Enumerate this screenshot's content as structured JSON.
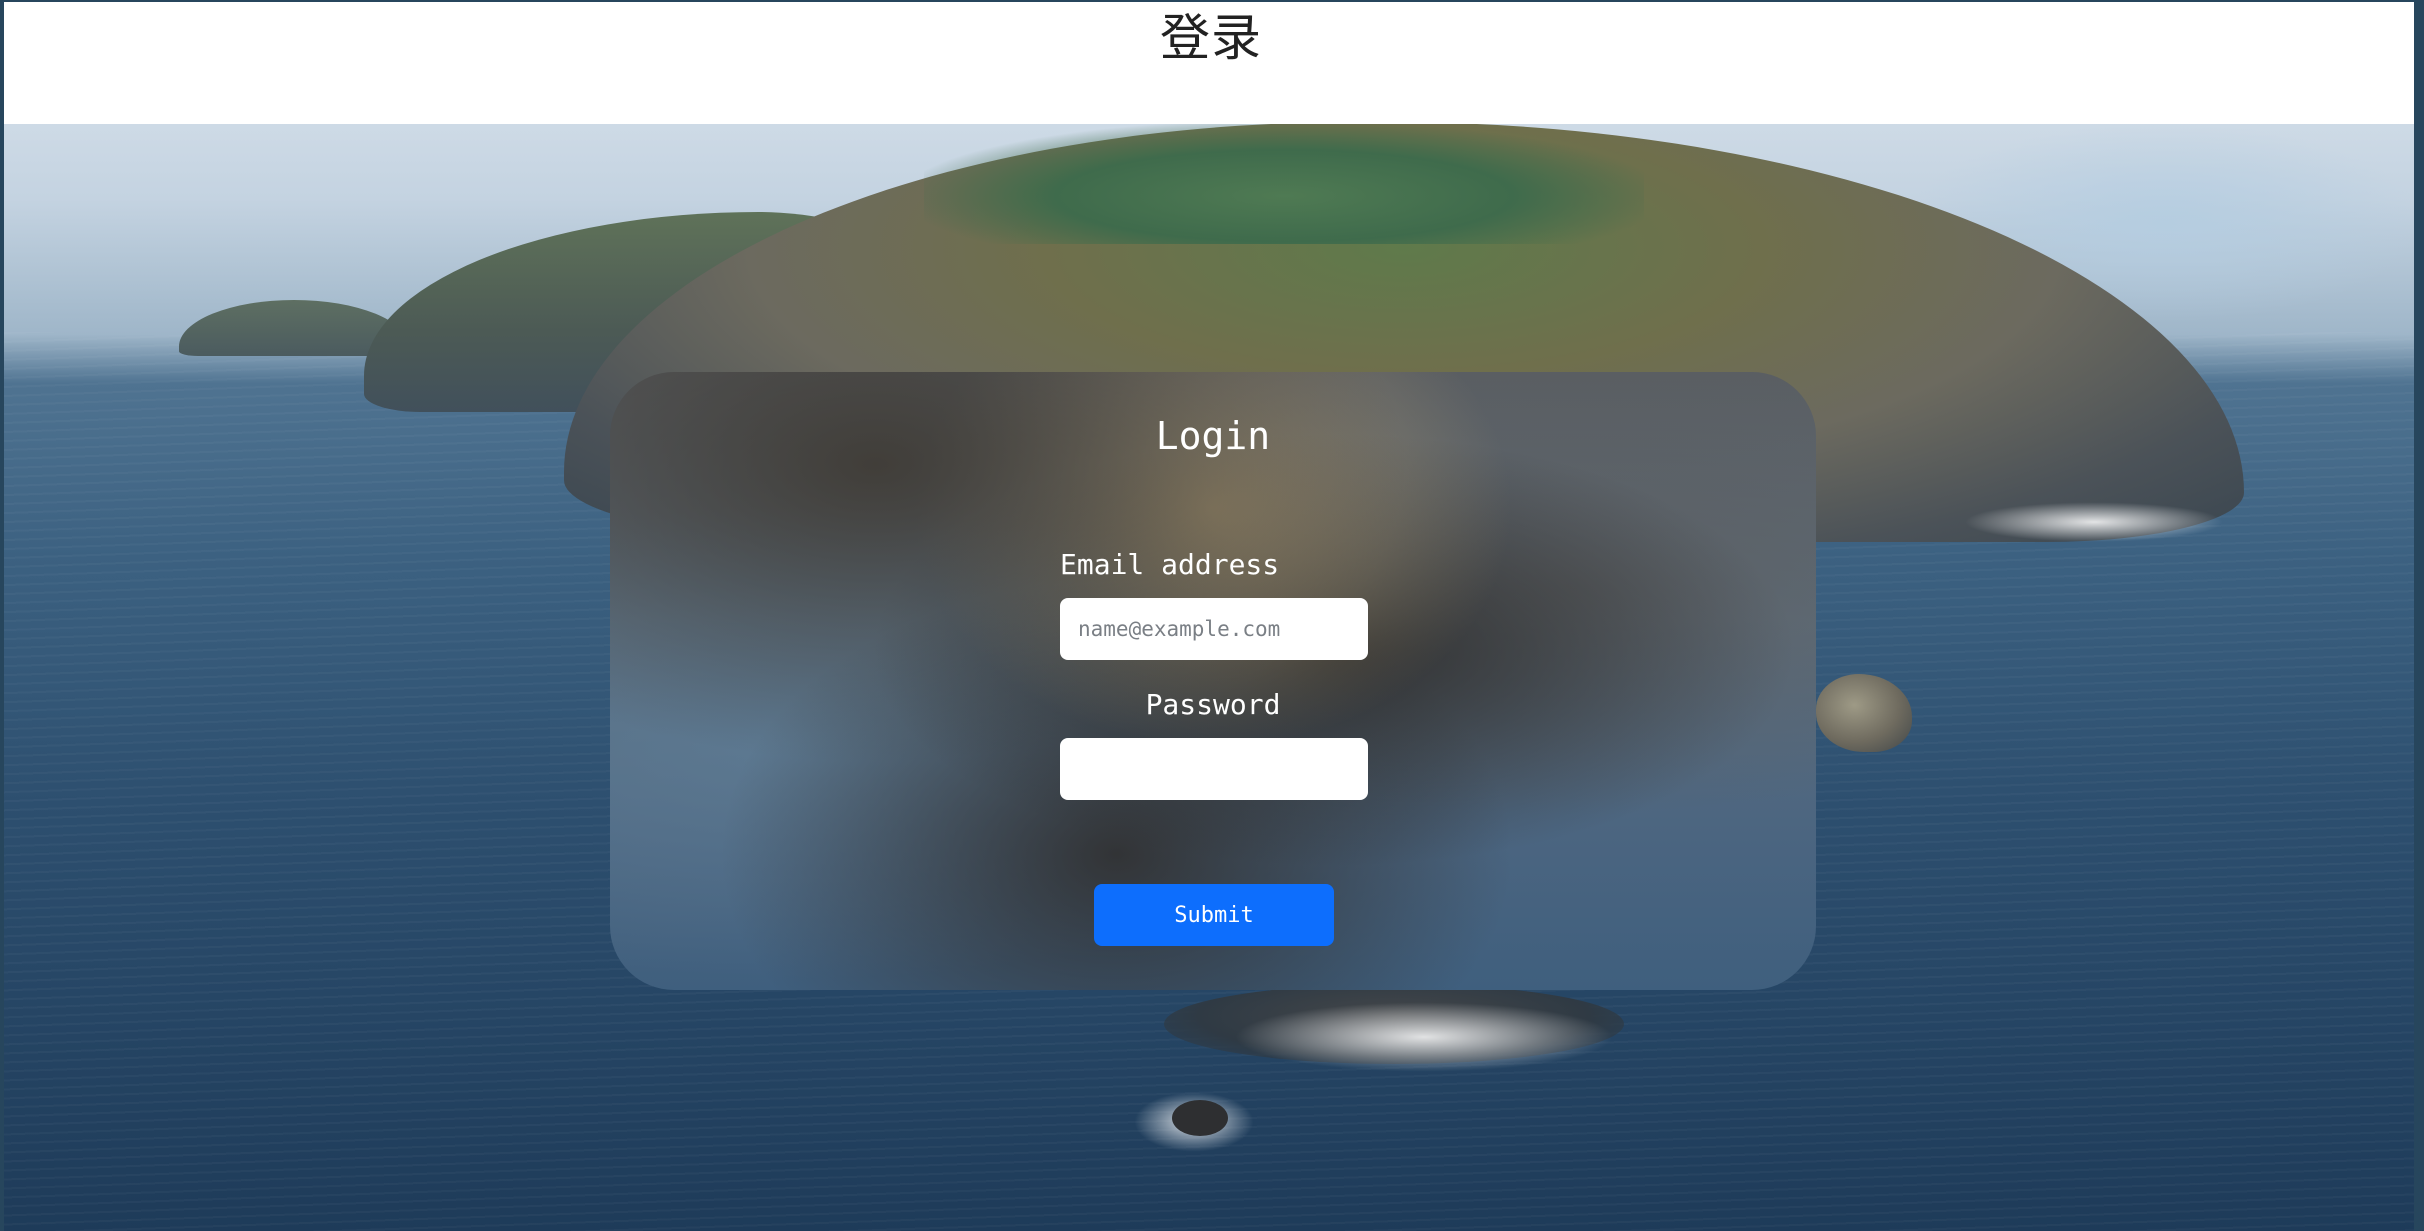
{
  "header": {
    "title": "登录"
  },
  "login_card": {
    "title": "Login",
    "email_label": "Email address",
    "email_placeholder": "name@example.com",
    "email_value": "",
    "password_label": "Password",
    "password_value": "",
    "submit_label": "Submit"
  },
  "colors": {
    "submit_button": "#0d6efd",
    "header_background": "#ffffff"
  }
}
